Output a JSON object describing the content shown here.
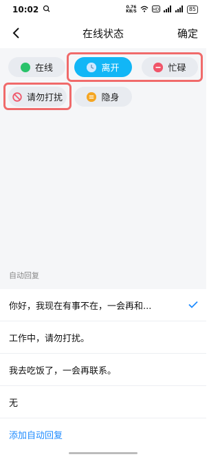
{
  "status_bar": {
    "time": "10:02",
    "left_icon": "notification-icon",
    "net_speed_value": "0.76",
    "net_speed_unit": "KB/S",
    "battery": "85",
    "icons": [
      "wifi-icon",
      "hd-icon",
      "signal-icon",
      "signal-icon",
      "battery-icon"
    ]
  },
  "nav": {
    "title": "在线状态",
    "confirm_label": "确定",
    "back_icon": "chevron-left-icon"
  },
  "statuses": [
    {
      "label": "在线",
      "icon": "green-dot-icon",
      "color": "#2ac26a",
      "selected": false
    },
    {
      "label": "离开",
      "icon": "clock-icon",
      "color": "#cfe8ff",
      "selected": true
    },
    {
      "label": "忙碌",
      "icon": "minus-circle-icon",
      "color": "#f0566a",
      "selected": false
    },
    {
      "label": "请勿打扰",
      "icon": "no-entry-icon",
      "color": "#f0566a",
      "selected": false
    },
    {
      "label": "隐身",
      "icon": "equals-circle-icon",
      "color": "#f5a623",
      "selected": false
    }
  ],
  "autoreply": {
    "header": "自动回复",
    "items": [
      {
        "text": "你好，我现在有事不在，一会再和...",
        "checked": true
      },
      {
        "text": "工作中，请勿打扰。",
        "checked": false
      },
      {
        "text": "我去吃饭了，一会再联系。",
        "checked": false
      },
      {
        "text": "无",
        "checked": false
      }
    ],
    "add_label": "添加自动回复",
    "check_icon": "checkmark-icon"
  },
  "colors": {
    "accent": "#12b6f6",
    "link": "#1e8bff",
    "highlight": "#f06a6a",
    "pill_bg": "#e8ebf0",
    "panel_bg": "#f5f6f8"
  }
}
